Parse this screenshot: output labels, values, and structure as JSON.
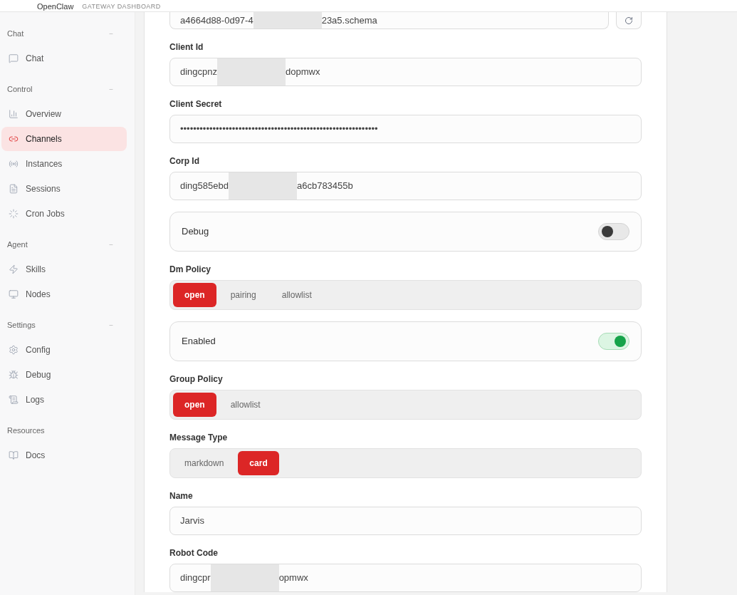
{
  "header": {
    "brand": "OpenClaw",
    "subtitle": "GATEWAY DASHBOARD"
  },
  "sidebar": {
    "sections": [
      {
        "title": "Chat",
        "collapse": "−",
        "items": [
          {
            "label": "Chat",
            "selected": false
          }
        ]
      },
      {
        "title": "Control",
        "collapse": "−",
        "items": [
          {
            "label": "Overview",
            "selected": false
          },
          {
            "label": "Channels",
            "selected": true
          },
          {
            "label": "Instances",
            "selected": false
          },
          {
            "label": "Sessions",
            "selected": false
          },
          {
            "label": "Cron Jobs",
            "selected": false
          }
        ]
      },
      {
        "title": "Agent",
        "collapse": "−",
        "items": [
          {
            "label": "Skills",
            "selected": false
          },
          {
            "label": "Nodes",
            "selected": false
          }
        ]
      },
      {
        "title": "Settings",
        "collapse": "−",
        "items": [
          {
            "label": "Config",
            "selected": false
          },
          {
            "label": "Debug",
            "selected": false
          },
          {
            "label": "Logs",
            "selected": false
          }
        ]
      },
      {
        "title": "Resources",
        "items": [
          {
            "label": "Docs",
            "selected": false
          }
        ]
      }
    ]
  },
  "form": [
    {
      "kind": "text",
      "value_before": "a4664d88-0d97-4",
      "value_after": "23a5.schema",
      "redacted": true,
      "refresh": true
    },
    {
      "kind": "text",
      "label": "Client Id",
      "value_before": "dingcpnz",
      "value_after": "dopmwx",
      "redacted": true
    },
    {
      "kind": "text",
      "label": "Client Secret",
      "value_before": "•••••••••••••••••••••••••••••••••••••••••••••••••••••••••••••"
    },
    {
      "kind": "text",
      "label": "Corp Id",
      "value_before": "ding585ebd",
      "value_after": "a6cb783455b",
      "redacted": true
    },
    {
      "kind": "toggle",
      "label": "Debug",
      "on": false
    },
    {
      "kind": "segmented",
      "label": "Dm Policy",
      "options": [
        {
          "label": "open",
          "selected": true
        },
        {
          "label": "pairing",
          "selected": false
        },
        {
          "label": "allowlist",
          "selected": false
        }
      ]
    },
    {
      "kind": "toggle",
      "label": "Enabled",
      "on": true
    },
    {
      "kind": "segmented",
      "label": "Group Policy",
      "options": [
        {
          "label": "open",
          "selected": true
        },
        {
          "label": "allowlist",
          "selected": false
        }
      ]
    },
    {
      "kind": "segmented",
      "label": "Message Type",
      "options": [
        {
          "label": "markdown",
          "selected": false
        },
        {
          "label": "card",
          "selected": true
        }
      ]
    },
    {
      "kind": "text",
      "label": "Name",
      "value_before": "Jarvis"
    },
    {
      "kind": "text",
      "label": "Robot Code",
      "value_before": "dingcpr",
      "value_after": "opmwx",
      "redacted": true
    }
  ]
}
